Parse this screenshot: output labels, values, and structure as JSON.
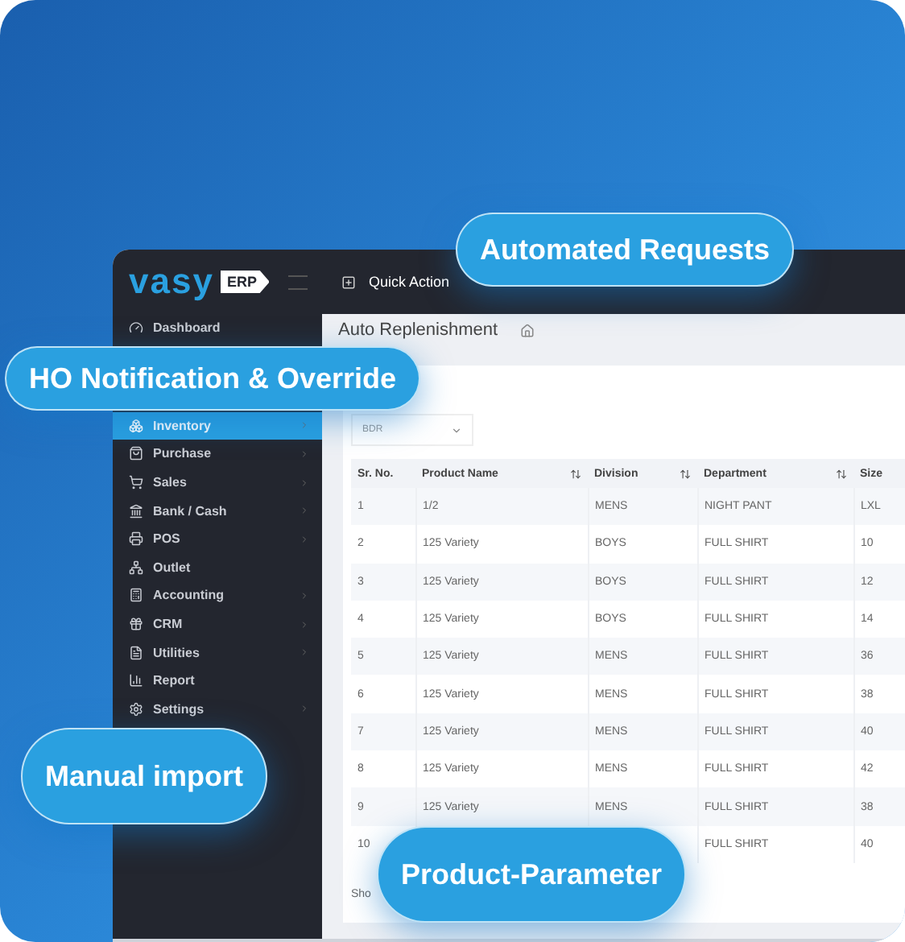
{
  "logo": {
    "name": "vasy",
    "badge": "ERP"
  },
  "header": {
    "quick_action": "Quick Action"
  },
  "sidebar": {
    "items": [
      {
        "label": "Dashboard",
        "selected": false,
        "chevron": false
      },
      {
        "label": "Inventory",
        "selected": true,
        "chevron": true
      },
      {
        "label": "Purchase",
        "selected": false,
        "chevron": true
      },
      {
        "label": "Sales",
        "selected": false,
        "chevron": true
      },
      {
        "label": "Bank / Cash",
        "selected": false,
        "chevron": true
      },
      {
        "label": "POS",
        "selected": false,
        "chevron": true
      },
      {
        "label": "Outlet",
        "selected": false,
        "chevron": false
      },
      {
        "label": "Accounting",
        "selected": false,
        "chevron": true
      },
      {
        "label": "CRM",
        "selected": false,
        "chevron": true
      },
      {
        "label": "Utilities",
        "selected": false,
        "chevron": true
      },
      {
        "label": "Report",
        "selected": false,
        "chevron": false
      },
      {
        "label": "Settings",
        "selected": false,
        "chevron": true
      }
    ]
  },
  "page": {
    "title": "Auto Replenishment",
    "filter": {
      "value": "BDR"
    },
    "footer": "Sho"
  },
  "table": {
    "columns": [
      {
        "label": "Sr. No.",
        "sortable": false
      },
      {
        "label": "Product Name",
        "sortable": true
      },
      {
        "label": "Division",
        "sortable": true
      },
      {
        "label": "Department",
        "sortable": true
      },
      {
        "label": "Size"
      }
    ],
    "rows": [
      [
        "1",
        "1/2",
        "MENS",
        "NIGHT PANT",
        "LXL"
      ],
      [
        "2",
        "125 Variety",
        "BOYS",
        "FULL SHIRT",
        "10"
      ],
      [
        "3",
        "125 Variety",
        "BOYS",
        "FULL SHIRT",
        "12"
      ],
      [
        "4",
        "125 Variety",
        "BOYS",
        "FULL SHIRT",
        "14"
      ],
      [
        "5",
        "125 Variety",
        "MENS",
        "FULL SHIRT",
        "36"
      ],
      [
        "6",
        "125 Variety",
        "MENS",
        "FULL SHIRT",
        "38"
      ],
      [
        "7",
        "125 Variety",
        "MENS",
        "FULL SHIRT",
        "40"
      ],
      [
        "8",
        "125 Variety",
        "MENS",
        "FULL SHIRT",
        "42"
      ],
      [
        "9",
        "125 Variety",
        "MENS",
        "FULL SHIRT",
        "38"
      ],
      [
        "10",
        null,
        null,
        "FULL SHIRT",
        "40"
      ]
    ]
  },
  "callouts": [
    "Automated Requests",
    "HO Notification & Override",
    "Manual import",
    "Product-Parameter"
  ]
}
